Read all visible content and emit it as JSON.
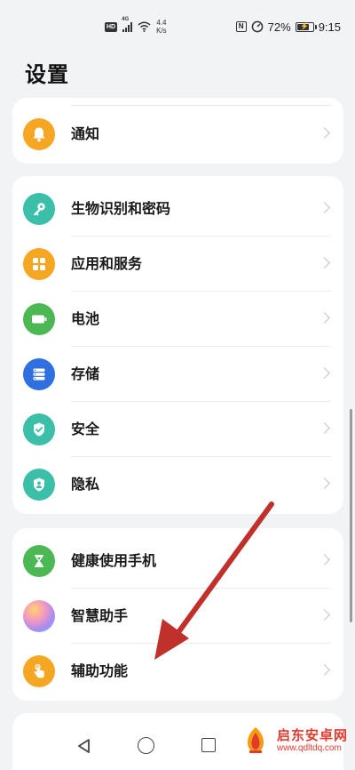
{
  "status_bar": {
    "network_badge": "HD",
    "network_type": "4G",
    "speed_value": "4.4",
    "speed_unit": "K/s",
    "battery_percent": "72%",
    "time": "9:15",
    "nfc_label": "N"
  },
  "page": {
    "title": "设置"
  },
  "groups": [
    {
      "items": [
        {
          "label": "通知",
          "icon": "bell-icon",
          "color": "#f5a623"
        }
      ]
    },
    {
      "items": [
        {
          "label": "生物识别和密码",
          "icon": "key-icon",
          "color": "#3bbfa8"
        },
        {
          "label": "应用和服务",
          "icon": "apps-grid-icon",
          "color": "#f5a623"
        },
        {
          "label": "电池",
          "icon": "battery-icon",
          "color": "#4cb854"
        },
        {
          "label": "存储",
          "icon": "storage-icon",
          "color": "#2f6fe0"
        },
        {
          "label": "安全",
          "icon": "shield-check-icon",
          "color": "#3bbfa8"
        },
        {
          "label": "隐私",
          "icon": "privacy-shield-icon",
          "color": "#3bbfa8"
        }
      ]
    },
    {
      "items": [
        {
          "label": "健康使用手机",
          "icon": "hourglass-icon",
          "color": "#4cb854"
        },
        {
          "label": "智慧助手",
          "icon": "assistant-orb-icon",
          "color": "#c58be8"
        },
        {
          "label": "辅助功能",
          "icon": "hand-touch-icon",
          "color": "#f5a623"
        }
      ]
    }
  ],
  "watermark": {
    "name": "启东安卓网",
    "url": "www.qdltdq.com"
  },
  "colors": {
    "background": "#f1f3f5",
    "card": "#ffffff",
    "annotation_arrow": "#c0312b"
  }
}
